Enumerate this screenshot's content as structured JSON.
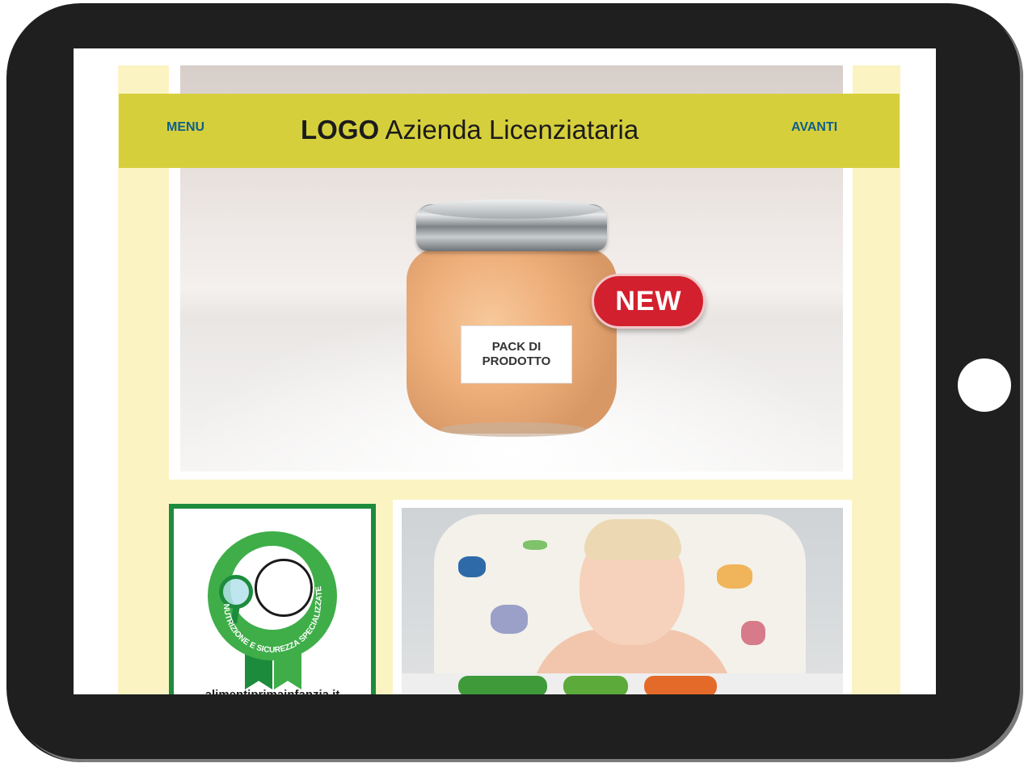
{
  "header": {
    "menu_label": "MENU",
    "title_bold": "LOGO",
    "title_rest": "Azienda Licenziataria",
    "avanti_label": "AVANTI"
  },
  "product": {
    "label_line1": "PACK DI",
    "label_line2": "PRODOTTO",
    "new_badge": "NEW"
  },
  "seal": {
    "ring_text": "NUTRIZIONE E SICUREZZA SPECIALIZZATE",
    "site": "alimentiprimainfanzia.it"
  },
  "colors": {
    "header_bar": "#d6cf3c",
    "link": "#0e5f8a",
    "page_bg": "#fbf4c2",
    "new_badge": "#d3202e",
    "seal_green": "#3fae49",
    "seal_dark_green": "#1d8b3c"
  }
}
